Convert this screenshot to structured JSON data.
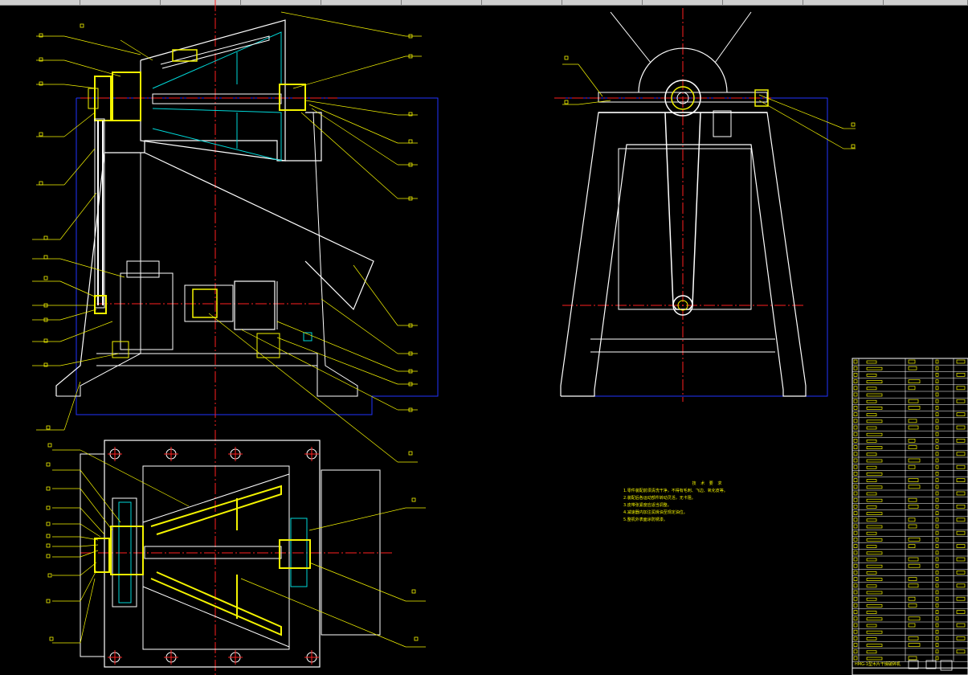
{
  "document": {
    "tabs": [
      {
        "label": ""
      },
      {
        "label": ""
      },
      {
        "label": ""
      },
      {
        "label": ""
      },
      {
        "label": ""
      },
      {
        "label": ""
      },
      {
        "label": ""
      },
      {
        "label": ""
      },
      {
        "label": ""
      },
      {
        "label": ""
      },
      {
        "label": ""
      },
      {
        "label": ""
      }
    ]
  },
  "drawing": {
    "colors": {
      "background": "#000000",
      "outline": "#ffffff",
      "center_line": "#ff2020",
      "hidden_line": "#00d8d8",
      "leader": "#f4f400",
      "frame": "#2233ff",
      "part_fill": "#f4f400"
    },
    "views": [
      "front-section-view",
      "side-view",
      "top-section-view"
    ],
    "technical_notes": {
      "title": "技 术 要 求",
      "lines": [
        "1.零件装配前须清洗干净，不得有毛刺、飞边、氧化皮等。",
        "2.装配后各运动部件转动灵活，无卡阻。",
        "3.皮带张紧度应适当调整。",
        "4.减速器内加注润滑油至规定油位。",
        "5.整机外表面涂防锈漆。"
      ]
    },
    "parts_list": {
      "title_block": "HMG-1型木片干燥破碎机"
    }
  }
}
